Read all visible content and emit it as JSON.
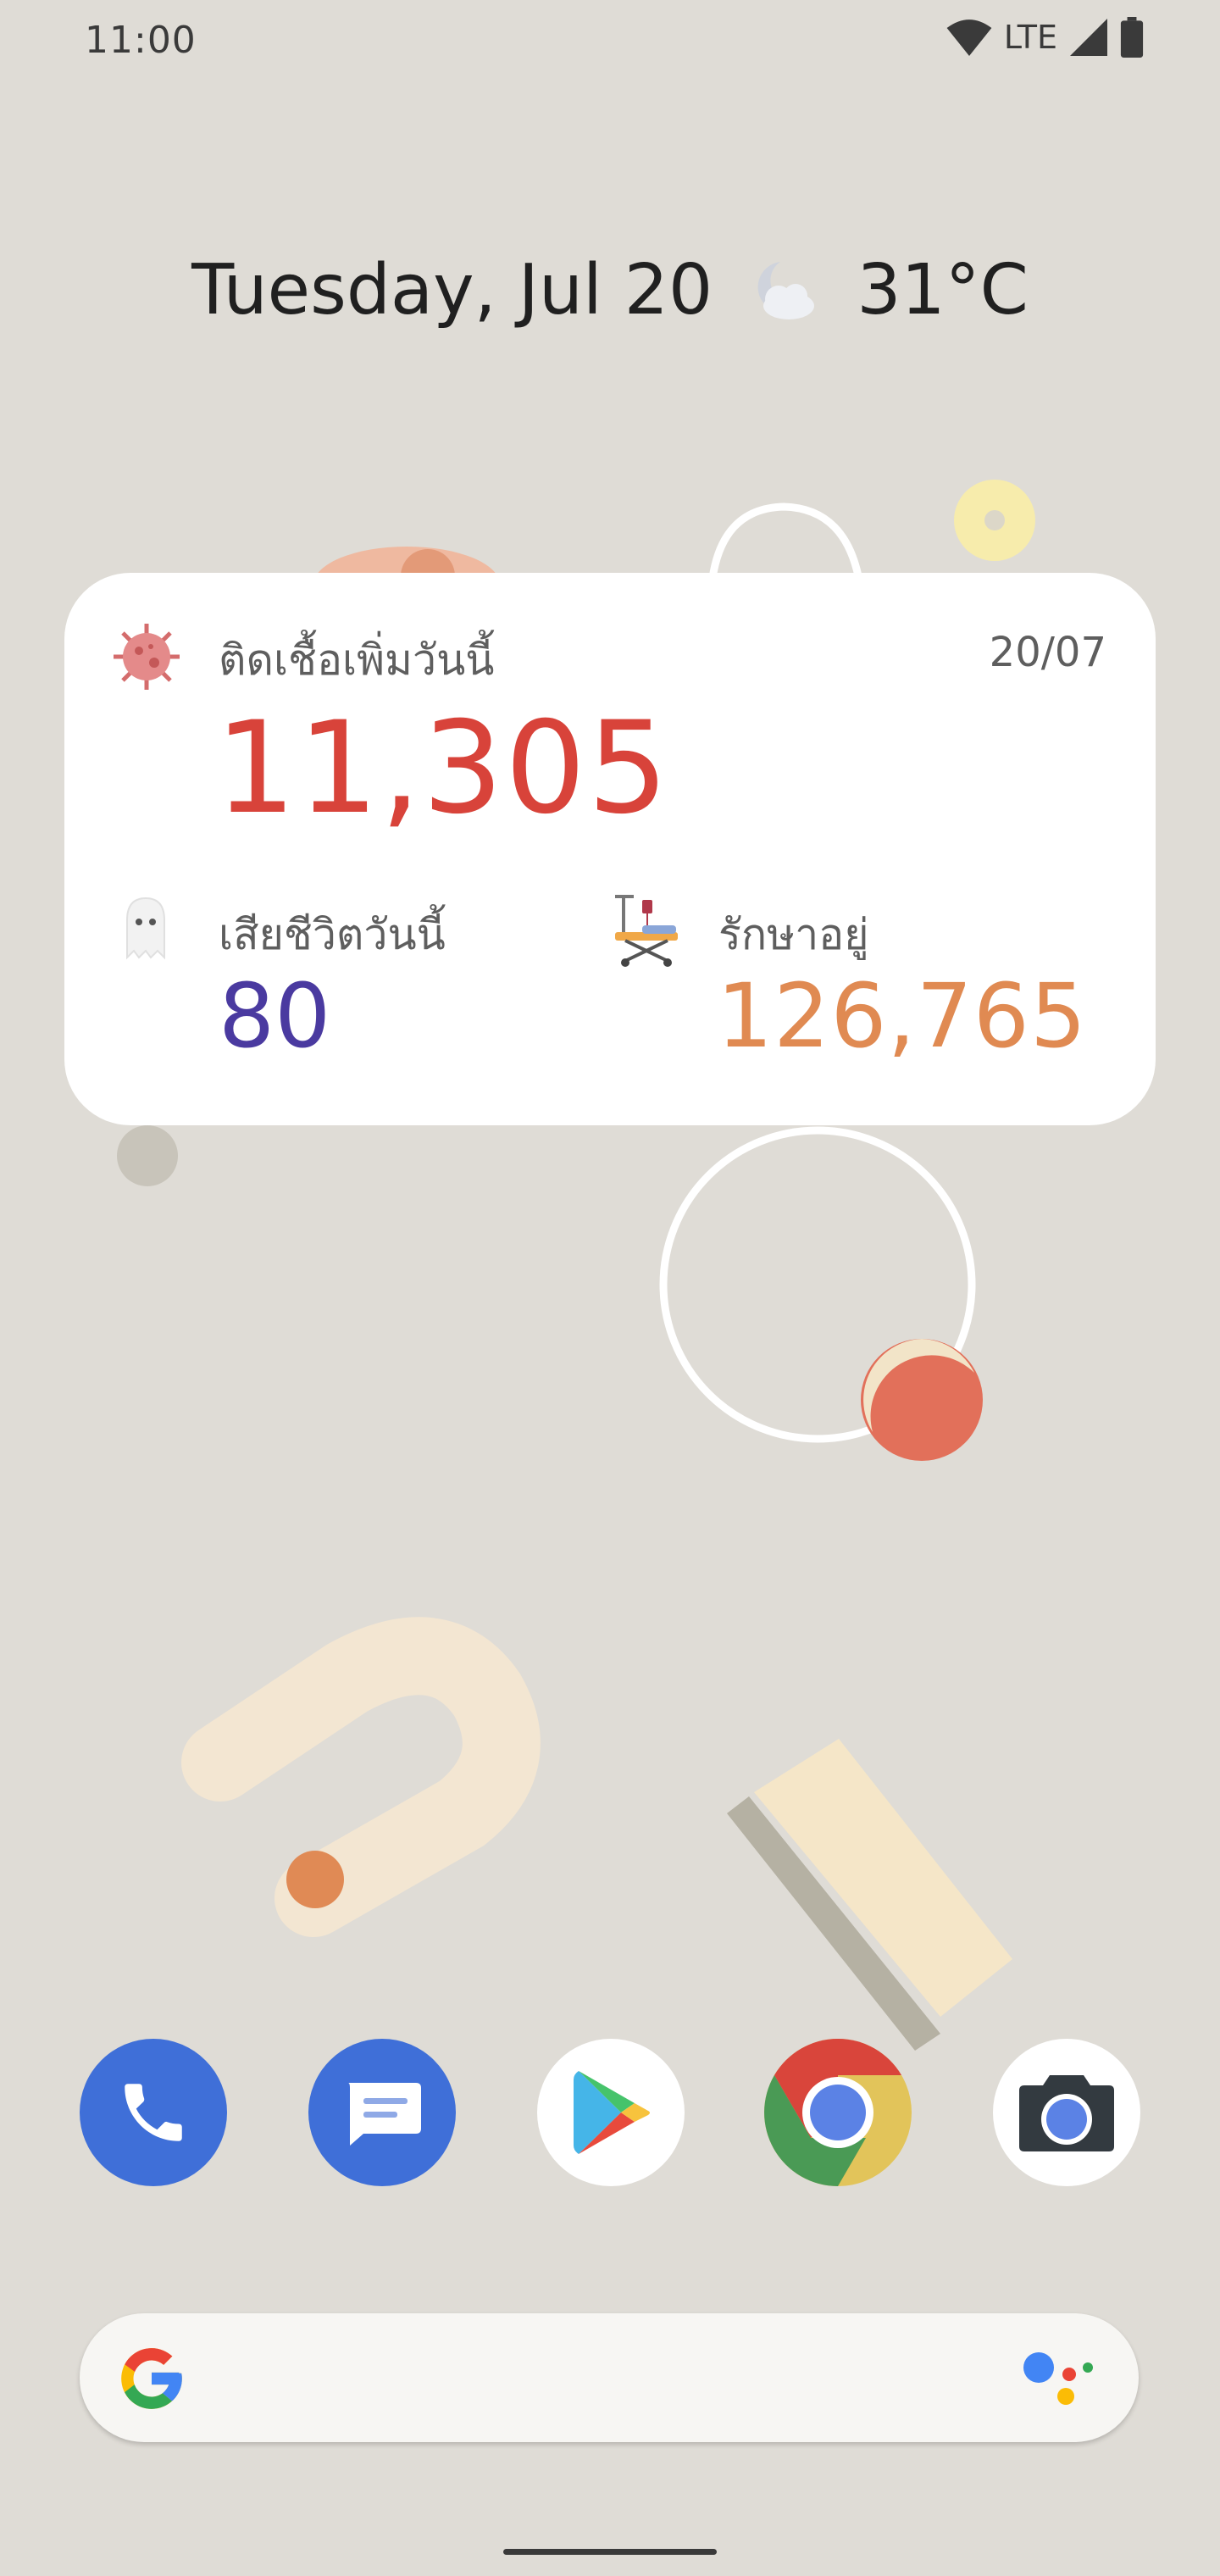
{
  "status_bar": {
    "time": "11:00",
    "network": "LTE",
    "icons": [
      "wifi-icon",
      "signal-icon",
      "battery-icon"
    ]
  },
  "date_weather": {
    "date": "Tuesday, Jul 20",
    "temperature": "31°C",
    "weather_icon": "moon-cloud-icon"
  },
  "covid_widget": {
    "new_cases_label": "ติดเชื้อเพิ่มวันนี้",
    "date": "20/07",
    "new_cases": "11,305",
    "deaths_label": "เสียชีวิตวันนี้",
    "deaths": "80",
    "treating_label": "รักษาอยู่",
    "treating": "126,765",
    "colors": {
      "cases": "#d8433a",
      "deaths": "#4a3aa0",
      "treating": "#e08a52"
    }
  },
  "dock": {
    "apps": [
      "Phone",
      "Messages",
      "Play Store",
      "Chrome",
      "Camera"
    ]
  },
  "search_bar": {
    "left_icon": "google-g-icon",
    "right_icon": "assistant-icon"
  }
}
